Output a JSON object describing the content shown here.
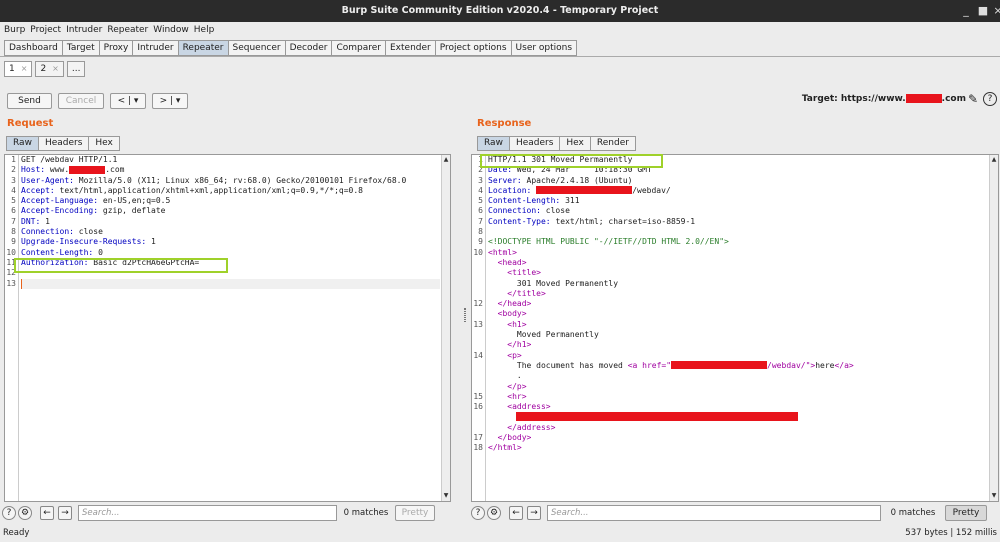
{
  "window": {
    "title": "Burp Suite Community Edition v2020.4 - Temporary Project"
  },
  "menu": [
    "Burp",
    "Project",
    "Intruder",
    "Repeater",
    "Window",
    "Help"
  ],
  "tabs": [
    "Dashboard",
    "Target",
    "Proxy",
    "Intruder",
    "Repeater",
    "Sequencer",
    "Decoder",
    "Comparer",
    "Extender",
    "Project options",
    "User options"
  ],
  "subtabs": [
    {
      "label": "1",
      "close": "×"
    },
    {
      "label": "2",
      "close": "×"
    },
    {
      "label": "..."
    }
  ],
  "toolbar": {
    "send": "Send",
    "cancel": "Cancel",
    "back": "<",
    "fwd": ">",
    "dd": "▾",
    "target_prefix": "Target: https://www.",
    "target_suffix": ".com"
  },
  "request": {
    "title": "Request",
    "tabs": [
      "Raw",
      "Headers",
      "Hex"
    ],
    "lines": [
      {
        "n": "1",
        "t": "GET /webdav HTTP/1.1"
      },
      {
        "n": "2",
        "h": "Host:",
        "v": " www.",
        "r": ".com"
      },
      {
        "n": "3",
        "h": "User-Agent:",
        "v": " Mozilla/5.0 (X11; Linux x86_64; rv:68.0) Gecko/20100101 Firefox/68.0"
      },
      {
        "n": "4",
        "h": "Accept:",
        "v": " text/html,application/xhtml+xml,application/xml;q=0.9,*/*;q=0.8"
      },
      {
        "n": "5",
        "h": "Accept-Language:",
        "v": " en-US,en;q=0.5"
      },
      {
        "n": "6",
        "h": "Accept-Encoding:",
        "v": " gzip, deflate"
      },
      {
        "n": "7",
        "h": "DNT:",
        "v": " 1"
      },
      {
        "n": "8",
        "h": "Connection:",
        "v": " close"
      },
      {
        "n": "9",
        "h": "Upgrade-Insecure-Requests:",
        "v": " 1"
      },
      {
        "n": "10",
        "h": "Content-Length:",
        "v": " 0"
      },
      {
        "n": "11",
        "h": "Authorization:",
        "v": " Basic d2PtcHA6eGPtcHA="
      },
      {
        "n": "12",
        "t": ""
      },
      {
        "n": "13",
        "t": ""
      }
    ]
  },
  "response": {
    "title": "Response",
    "tabs": [
      "Raw",
      "Headers",
      "Hex",
      "Render"
    ],
    "lines": [
      {
        "n": "1",
        "t": "HTTP/1.1 301 Moved Permanently"
      },
      {
        "n": "2",
        "h": "Date:",
        "v": " Wed, 24 Mar     10:18:30 GMT"
      },
      {
        "n": "3",
        "h": "Server:",
        "v": " Apache/2.4.18 (Ubuntu)"
      },
      {
        "n": "4",
        "h": "Location:",
        "v": " ",
        "r2": "/webdav/"
      },
      {
        "n": "5",
        "h": "Content-Length:",
        "v": " 311"
      },
      {
        "n": "6",
        "h": "Connection:",
        "v": " close"
      },
      {
        "n": "7",
        "h": "Content-Type:",
        "v": " text/html; charset=iso-8859-1"
      },
      {
        "n": "8",
        "t": ""
      },
      {
        "n": "9",
        "g": "<!DOCTYPE HTML PUBLIC \"-//IETF//DTD HTML 2.0//EN\">"
      },
      {
        "n": "10",
        "g2": "<html>"
      },
      {
        "n": "",
        "g2": "  <head>"
      },
      {
        "n": "",
        "g2": "    <title>"
      },
      {
        "n": "",
        "t": "      301 Moved Permanently"
      },
      {
        "n": "",
        "g2": "    </title>"
      },
      {
        "n": "12",
        "g2": "  </head>"
      },
      {
        "n": "",
        "g2": "  <body>"
      },
      {
        "n": "13",
        "g2": "    <h1>"
      },
      {
        "n": "",
        "t": "      Moved Permanently"
      },
      {
        "n": "",
        "g2": "    </h1>"
      },
      {
        "n": "14",
        "g2": "    <p>"
      },
      {
        "n": "",
        "a": "      The document has moved ",
        "b": "<a href=\"",
        "c": "/webdav/\">",
        "d": "here",
        "e": "</a>"
      },
      {
        "n": "",
        "t": "      ."
      },
      {
        "n": "",
        "g2": "    </p>"
      },
      {
        "n": "15",
        "g2": "    <hr>"
      },
      {
        "n": "16",
        "g2": "    <address>"
      },
      {
        "n": "",
        "t": ""
      },
      {
        "n": "",
        "g2": "    </address>"
      },
      {
        "n": "17",
        "g2": "  </body>"
      },
      {
        "n": "18",
        "g2": "</html>"
      }
    ]
  },
  "bottom": {
    "search_placeholder": "Search...",
    "matches": "0 matches",
    "pretty": "Pretty"
  },
  "status": {
    "left": "Ready",
    "right": "537 bytes | 152 millis"
  },
  "colors": {
    "accent": "#e8631c",
    "highlight": "#9fd12a",
    "redaction": "#e8141c"
  }
}
